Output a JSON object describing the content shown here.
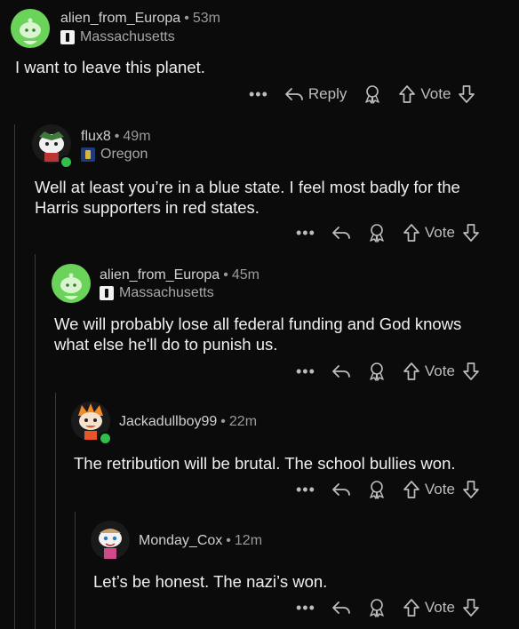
{
  "comments": [
    {
      "username": "alien_from_Europa",
      "time": "53m",
      "flair": "Massachusetts",
      "body": "I want to leave this planet.",
      "actions": {
        "more": "•••",
        "reply": "Reply",
        "vote": "Vote"
      }
    },
    {
      "username": "flux8",
      "time": "49m",
      "flair": "Oregon",
      "body_line1": "Well at least you’re in a blue state.  I feel most badly for the",
      "body_line2": "Harris supporters in red states.",
      "actions": {
        "more": "•••",
        "vote": "Vote"
      }
    },
    {
      "username": "alien_from_Europa",
      "time": "45m",
      "flair": "Massachusetts",
      "body_line1": "We will probably lose all federal funding and God knows",
      "body_line2": "what else he'll do to punish us.",
      "actions": {
        "more": "•••",
        "vote": "Vote"
      }
    },
    {
      "username": "Jackadullboy99",
      "time": "22m",
      "body": "The retribution will be brutal. The school bullies won.",
      "actions": {
        "more": "•••",
        "vote": "Vote"
      }
    },
    {
      "username": "Monday_Cox",
      "time": "12m",
      "body": "Let’s be honest. The nazi’s won.",
      "actions": {
        "more": "•••",
        "vote": "Vote"
      }
    }
  ],
  "separator": "•",
  "colors": {
    "background": "#0b0b0b",
    "avatar_green": "#6bd35a",
    "online": "#2fbf4a"
  }
}
